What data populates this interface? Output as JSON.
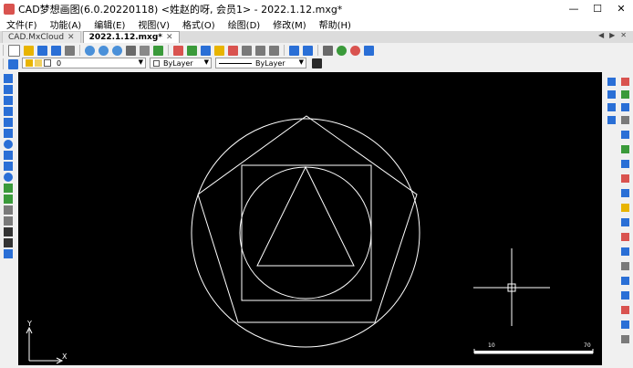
{
  "window": {
    "title": "CAD梦想画图(6.0.20220118) <姓赵的呀, 会员1> - 2022.1.12.mxg*",
    "minimize": "—",
    "maximize": "☐",
    "close": "✕"
  },
  "menu": [
    {
      "label": "文件(F)"
    },
    {
      "label": "功能(A)"
    },
    {
      "label": "编辑(E)"
    },
    {
      "label": "视图(V)"
    },
    {
      "label": "格式(O)"
    },
    {
      "label": "绘图(D)"
    },
    {
      "label": "修改(M)"
    },
    {
      "label": "帮助(H)"
    }
  ],
  "tabs": [
    {
      "label": "CAD.MxCloud",
      "close": "✕",
      "active": false
    },
    {
      "label": "2022.1.12.mxg*",
      "close": "✕",
      "active": true
    }
  ],
  "tab_nav": {
    "prev": "◀",
    "next": "▶",
    "close": "✕"
  },
  "layer_combo": {
    "value": "0"
  },
  "color_combo": {
    "value": "ByLayer"
  },
  "linetype_combo": {
    "value": "ByLayer"
  },
  "colors": {
    "canvas": "#000000",
    "geometry": "#ffffff",
    "accent_blue": "#2a6fd6",
    "accent_green": "#3a9a3a",
    "accent_red": "#d9534f",
    "accent_yellow": "#e8b400"
  },
  "ucs": {
    "y_label": "Y",
    "x_label": "X"
  },
  "scale_bar": {
    "left": "10",
    "right": "70"
  },
  "left_tools": [
    "line-tool",
    "construction-line-tool",
    "polyline-tool",
    "polygon-tool",
    "rectangle-tool",
    "arc-tool",
    "circle-tool",
    "revision-cloud-tool",
    "spline-tool",
    "ellipse-tool",
    "insert-block-tool",
    "make-block-tool",
    "point-tool",
    "hatch-tool",
    "text-tool",
    "mtext-tool",
    "table-tool"
  ],
  "right_tools": [
    "erase-tool",
    "copy-tool",
    "mirror-tool",
    "offset-tool",
    "array-tool",
    "move-tool",
    "rotate-tool",
    "scale-tool",
    "stretch-tool",
    "trim-tool",
    "extend-tool",
    "break-tool",
    "join-tool",
    "chamfer-tool",
    "fillet-tool",
    "explode-tool"
  ]
}
